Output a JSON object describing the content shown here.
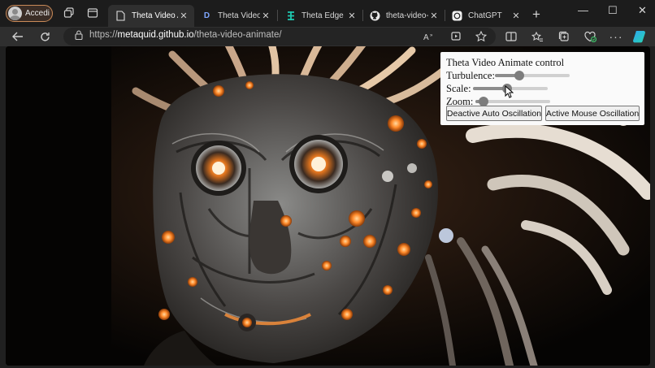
{
  "browser": {
    "profile": {
      "label": "Accedi",
      "icon": "avatar-icon"
    },
    "tabs": [
      {
        "title": "Theta Video A",
        "favicon": "document-icon",
        "active": true
      },
      {
        "title": "Theta Video A",
        "favicon_letter": "D",
        "active": false
      },
      {
        "title": "Theta Edge Cl",
        "favicon": "theta-logo-icon",
        "active": false
      },
      {
        "title": "theta-video-a",
        "favicon": "github-icon",
        "active": false
      },
      {
        "title": "ChatGPT",
        "favicon": "chatgpt-icon",
        "active": false
      }
    ],
    "address": {
      "prefix": "https://",
      "domain": "metaquid.github.io",
      "path": "/theta-video-animate/"
    },
    "colors": {
      "tabbar": "#1c1c1c",
      "toolbar": "#2f2f2f",
      "accent": "#2ea7f2"
    }
  },
  "panel": {
    "title": "Theta Video Animate control",
    "controls": [
      {
        "label": "Turbulence:",
        "value": 0.3
      },
      {
        "label": "Scale:",
        "value": 0.45
      },
      {
        "label": "Zoom:",
        "value": 0.05
      }
    ],
    "buttons": [
      {
        "label": "Deactive Auto Oscillation"
      },
      {
        "label": "Active Mouse Oscillation"
      }
    ]
  }
}
